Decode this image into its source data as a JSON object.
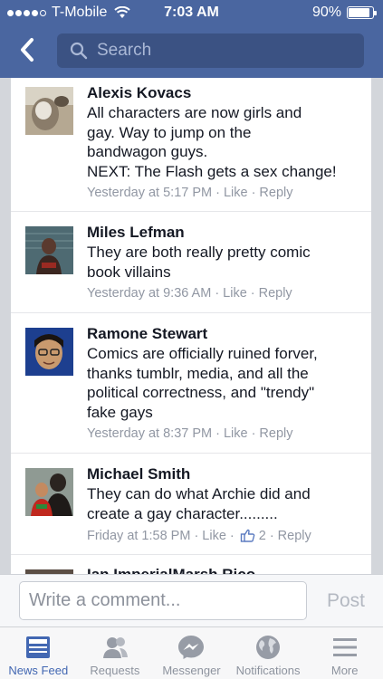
{
  "status_bar": {
    "carrier": "T-Mobile",
    "time": "7:03 AM",
    "battery": "90%",
    "battery_level": 0.9
  },
  "header": {
    "search_placeholder": "Search"
  },
  "comments": [
    {
      "name": "Alexis Kovacs",
      "lines": [
        "All characters are now girls and",
        "gay. Way to jump on the",
        "bandwagon guys.",
        "NEXT: The Flash gets a sex change!"
      ],
      "time": "Yesterday at 5:17 PM",
      "like": "Like",
      "reply": "Reply"
    },
    {
      "name": "Miles Lefman",
      "lines": [
        "They are both really pretty comic",
        "book villains"
      ],
      "time": "Yesterday at 9:36 AM",
      "like": "Like",
      "reply": "Reply"
    },
    {
      "name": "Ramone Stewart",
      "lines": [
        "Comics are officially ruined forver,",
        "thanks tumblr, media, and all the",
        "political correctness, and \"trendy\"",
        "fake gays"
      ],
      "time": "Yesterday at 8:37 PM",
      "like": "Like",
      "reply": "Reply"
    },
    {
      "name": "Michael Smith",
      "lines": [
        "They can do what Archie did and",
        "create a gay character........."
      ],
      "time": "Friday at 1:58 PM",
      "like": "Like",
      "like_count": "2",
      "reply": "Reply"
    }
  ],
  "partial_comment_name": "Ian ImperialMarsh Rico",
  "composer": {
    "placeholder": "Write a comment...",
    "post_label": "Post"
  },
  "tabs": [
    {
      "label": "News Feed",
      "icon": "news-feed-icon",
      "active": true
    },
    {
      "label": "Requests",
      "icon": "friend-requests-icon"
    },
    {
      "label": "Messenger",
      "icon": "messenger-icon"
    },
    {
      "label": "Notifications",
      "icon": "globe-icon"
    },
    {
      "label": "More",
      "icon": "menu-icon"
    }
  ],
  "colors": {
    "header_blue": "#4a66a0",
    "accent": "#4267b2"
  }
}
